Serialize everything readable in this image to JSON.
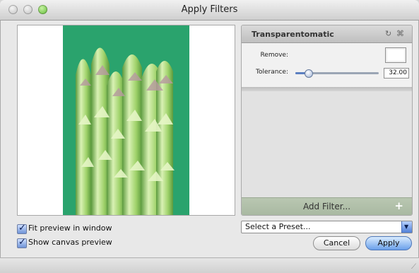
{
  "window": {
    "title": "Apply Filters"
  },
  "filter": {
    "name": "Transparentomatic",
    "refresh_icon": "↻",
    "close_icon": "⌘",
    "remove_label": "Remove:",
    "tolerance_label": "Tolerance:",
    "tolerance_value": "32.00",
    "tolerance_fraction": 0.15
  },
  "filters_panel": {
    "add_filter_label": "Add Filter...",
    "add_icon": "+"
  },
  "options": {
    "fit_preview_label": "Fit preview in window",
    "show_canvas_label": "Show canvas preview"
  },
  "preset": {
    "selected": "Select a Preset..."
  },
  "buttons": {
    "cancel": "Cancel",
    "apply": "Apply"
  },
  "colors": {
    "preview_background": "#2aa36d",
    "asparagus_light": "#e6f6c6",
    "asparagus_mid": "#9fd26a",
    "asparagus_dark": "#5b9a3d",
    "tip_purple": "#b79aa0"
  }
}
